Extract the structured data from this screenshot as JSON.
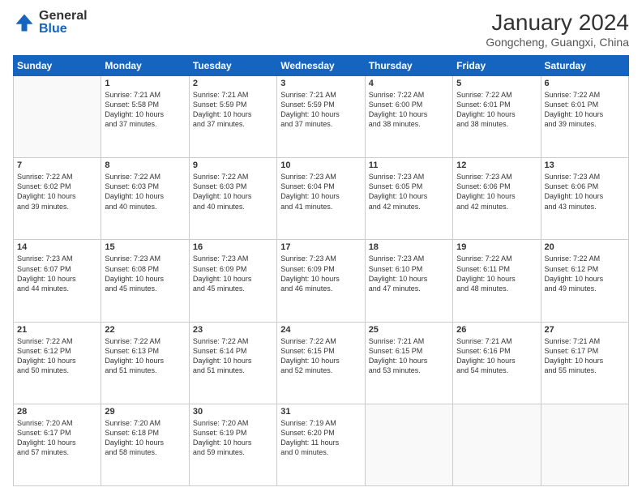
{
  "header": {
    "logo_general": "General",
    "logo_blue": "Blue",
    "month_year": "January 2024",
    "location": "Gongcheng, Guangxi, China"
  },
  "columns": [
    "Sunday",
    "Monday",
    "Tuesday",
    "Wednesday",
    "Thursday",
    "Friday",
    "Saturday"
  ],
  "weeks": [
    [
      {
        "num": "",
        "info": ""
      },
      {
        "num": "1",
        "info": "Sunrise: 7:21 AM\nSunset: 5:58 PM\nDaylight: 10 hours\nand 37 minutes."
      },
      {
        "num": "2",
        "info": "Sunrise: 7:21 AM\nSunset: 5:59 PM\nDaylight: 10 hours\nand 37 minutes."
      },
      {
        "num": "3",
        "info": "Sunrise: 7:21 AM\nSunset: 5:59 PM\nDaylight: 10 hours\nand 37 minutes."
      },
      {
        "num": "4",
        "info": "Sunrise: 7:22 AM\nSunset: 6:00 PM\nDaylight: 10 hours\nand 38 minutes."
      },
      {
        "num": "5",
        "info": "Sunrise: 7:22 AM\nSunset: 6:01 PM\nDaylight: 10 hours\nand 38 minutes."
      },
      {
        "num": "6",
        "info": "Sunrise: 7:22 AM\nSunset: 6:01 PM\nDaylight: 10 hours\nand 39 minutes."
      }
    ],
    [
      {
        "num": "7",
        "info": "Sunrise: 7:22 AM\nSunset: 6:02 PM\nDaylight: 10 hours\nand 39 minutes."
      },
      {
        "num": "8",
        "info": "Sunrise: 7:22 AM\nSunset: 6:03 PM\nDaylight: 10 hours\nand 40 minutes."
      },
      {
        "num": "9",
        "info": "Sunrise: 7:22 AM\nSunset: 6:03 PM\nDaylight: 10 hours\nand 40 minutes."
      },
      {
        "num": "10",
        "info": "Sunrise: 7:23 AM\nSunset: 6:04 PM\nDaylight: 10 hours\nand 41 minutes."
      },
      {
        "num": "11",
        "info": "Sunrise: 7:23 AM\nSunset: 6:05 PM\nDaylight: 10 hours\nand 42 minutes."
      },
      {
        "num": "12",
        "info": "Sunrise: 7:23 AM\nSunset: 6:06 PM\nDaylight: 10 hours\nand 42 minutes."
      },
      {
        "num": "13",
        "info": "Sunrise: 7:23 AM\nSunset: 6:06 PM\nDaylight: 10 hours\nand 43 minutes."
      }
    ],
    [
      {
        "num": "14",
        "info": "Sunrise: 7:23 AM\nSunset: 6:07 PM\nDaylight: 10 hours\nand 44 minutes."
      },
      {
        "num": "15",
        "info": "Sunrise: 7:23 AM\nSunset: 6:08 PM\nDaylight: 10 hours\nand 45 minutes."
      },
      {
        "num": "16",
        "info": "Sunrise: 7:23 AM\nSunset: 6:09 PM\nDaylight: 10 hours\nand 45 minutes."
      },
      {
        "num": "17",
        "info": "Sunrise: 7:23 AM\nSunset: 6:09 PM\nDaylight: 10 hours\nand 46 minutes."
      },
      {
        "num": "18",
        "info": "Sunrise: 7:23 AM\nSunset: 6:10 PM\nDaylight: 10 hours\nand 47 minutes."
      },
      {
        "num": "19",
        "info": "Sunrise: 7:22 AM\nSunset: 6:11 PM\nDaylight: 10 hours\nand 48 minutes."
      },
      {
        "num": "20",
        "info": "Sunrise: 7:22 AM\nSunset: 6:12 PM\nDaylight: 10 hours\nand 49 minutes."
      }
    ],
    [
      {
        "num": "21",
        "info": "Sunrise: 7:22 AM\nSunset: 6:12 PM\nDaylight: 10 hours\nand 50 minutes."
      },
      {
        "num": "22",
        "info": "Sunrise: 7:22 AM\nSunset: 6:13 PM\nDaylight: 10 hours\nand 51 minutes."
      },
      {
        "num": "23",
        "info": "Sunrise: 7:22 AM\nSunset: 6:14 PM\nDaylight: 10 hours\nand 51 minutes."
      },
      {
        "num": "24",
        "info": "Sunrise: 7:22 AM\nSunset: 6:15 PM\nDaylight: 10 hours\nand 52 minutes."
      },
      {
        "num": "25",
        "info": "Sunrise: 7:21 AM\nSunset: 6:15 PM\nDaylight: 10 hours\nand 53 minutes."
      },
      {
        "num": "26",
        "info": "Sunrise: 7:21 AM\nSunset: 6:16 PM\nDaylight: 10 hours\nand 54 minutes."
      },
      {
        "num": "27",
        "info": "Sunrise: 7:21 AM\nSunset: 6:17 PM\nDaylight: 10 hours\nand 55 minutes."
      }
    ],
    [
      {
        "num": "28",
        "info": "Sunrise: 7:20 AM\nSunset: 6:17 PM\nDaylight: 10 hours\nand 57 minutes."
      },
      {
        "num": "29",
        "info": "Sunrise: 7:20 AM\nSunset: 6:18 PM\nDaylight: 10 hours\nand 58 minutes."
      },
      {
        "num": "30",
        "info": "Sunrise: 7:20 AM\nSunset: 6:19 PM\nDaylight: 10 hours\nand 59 minutes."
      },
      {
        "num": "31",
        "info": "Sunrise: 7:19 AM\nSunset: 6:20 PM\nDaylight: 11 hours\nand 0 minutes."
      },
      {
        "num": "",
        "info": ""
      },
      {
        "num": "",
        "info": ""
      },
      {
        "num": "",
        "info": ""
      }
    ]
  ]
}
